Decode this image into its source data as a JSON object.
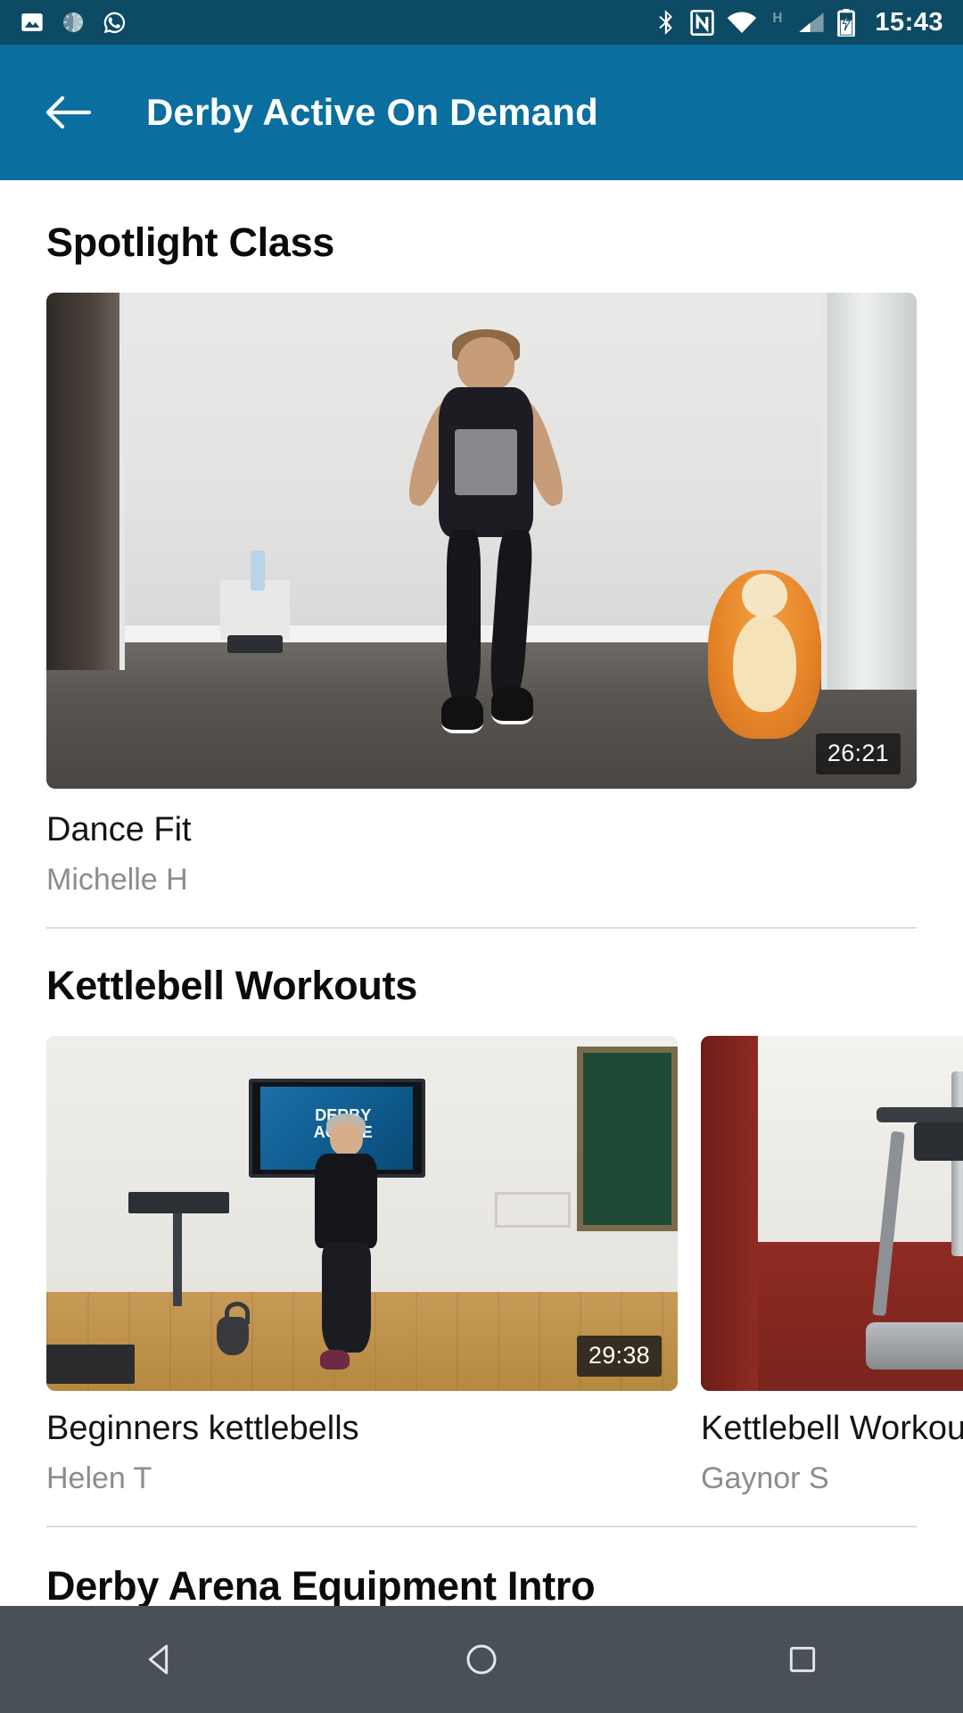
{
  "status_bar": {
    "time": "15:43",
    "left_icons": [
      "photo-icon",
      "sync-progress-icon",
      "whatsapp-icon"
    ],
    "right_icons": [
      "bluetooth-icon",
      "nfc-icon",
      "wifi-icon",
      "network-h-icon",
      "signal-icon",
      "battery-charging-icon"
    ],
    "network_type": "H",
    "background_color": "#0d4a63"
  },
  "app_bar": {
    "back_label": "back-arrow",
    "title": "Derby Active On Demand",
    "background_color": "#0a6e9e"
  },
  "sections": [
    {
      "title": "Spotlight Class",
      "layout": "single",
      "items": [
        {
          "title": "Dance Fit",
          "instructor": "Michelle H",
          "duration": "26:21"
        }
      ]
    },
    {
      "title": "Kettlebell Workouts",
      "layout": "carousel",
      "items": [
        {
          "title": "Beginners kettlebells",
          "instructor": "Helen T",
          "duration": "29:38"
        },
        {
          "title": "Kettlebell Workout",
          "instructor": "Gaynor S",
          "duration": ""
        }
      ]
    },
    {
      "title": "Derby Arena Equipment Intro",
      "layout": "peek",
      "items": []
    }
  ],
  "thumbnail_overlay": {
    "tv_screen_text": "DERBY ACTIVE"
  },
  "nav_bar": {
    "buttons": [
      "back-triangle-icon",
      "home-circle-icon",
      "recents-square-icon"
    ],
    "background_color": "#4a5057"
  }
}
